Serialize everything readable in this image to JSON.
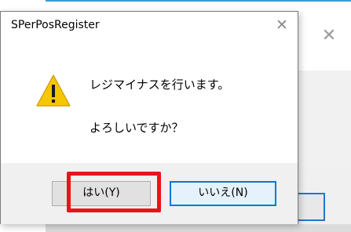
{
  "dialog": {
    "title": "SPerPosRegister",
    "close_glyph": "✕",
    "icon": "warning-icon",
    "message_line1": "レジマイナスを行います。",
    "message_line2": "よろしいですか？",
    "yes_label": "はい(Y)",
    "no_label": "いいえ(N)"
  },
  "background_window": {
    "close_glyph": "✕"
  },
  "colors": {
    "highlight": "#e8141c",
    "focus_border": "#0078d7",
    "warning_fill": "#f6c700"
  }
}
